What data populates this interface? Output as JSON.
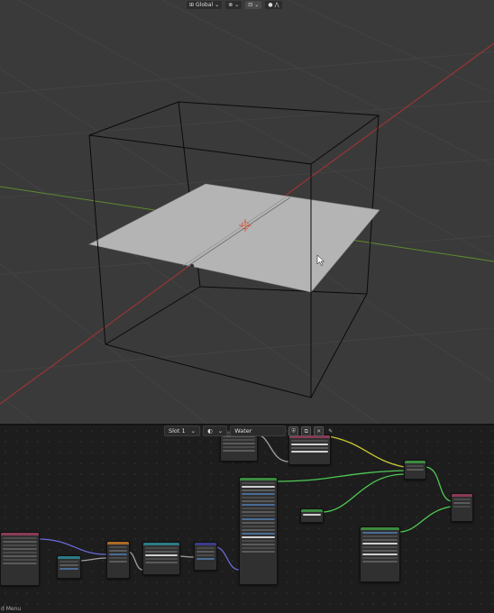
{
  "viewport_header": {
    "orientation_label": "Global",
    "orientation_icon": "axis-transform-icon",
    "snap_icon": "snap-icon",
    "proportional_icon": "proportional-edit-icon",
    "overlay_icon": "overlay-icon",
    "xray_icon": "xray-icon"
  },
  "node_editor_header": {
    "slot_label": "Slot 1",
    "material_icon": "material-sphere-icon",
    "material_name": "Water",
    "shield_icon": "fake-user-shield-icon",
    "copy_icon": "duplicate-icon",
    "close_icon": "close-icon",
    "pin_icon": "pin-icon"
  },
  "status_bar": {
    "text": "d Menu"
  },
  "colors": {
    "viewport_bg": "#3a3a3a",
    "grid_line": "#444444",
    "x_axis": "#9a3434",
    "y_axis": "#5f8a2d",
    "plane_fill": "#b4b4b4",
    "wire": "#000000",
    "editor_bg": "#1d1d1d",
    "link_vector": "#6a6ad8",
    "link_color": "#c8c832",
    "link_shader": "#4ecb54",
    "link_float": "#a1a1a1",
    "header_shader": "#3b8a3f",
    "header_input": "#8a3a56",
    "header_texture": "#ae6a26",
    "header_vector": "#3b3b8a",
    "header_converter": "#2c7b86"
  }
}
